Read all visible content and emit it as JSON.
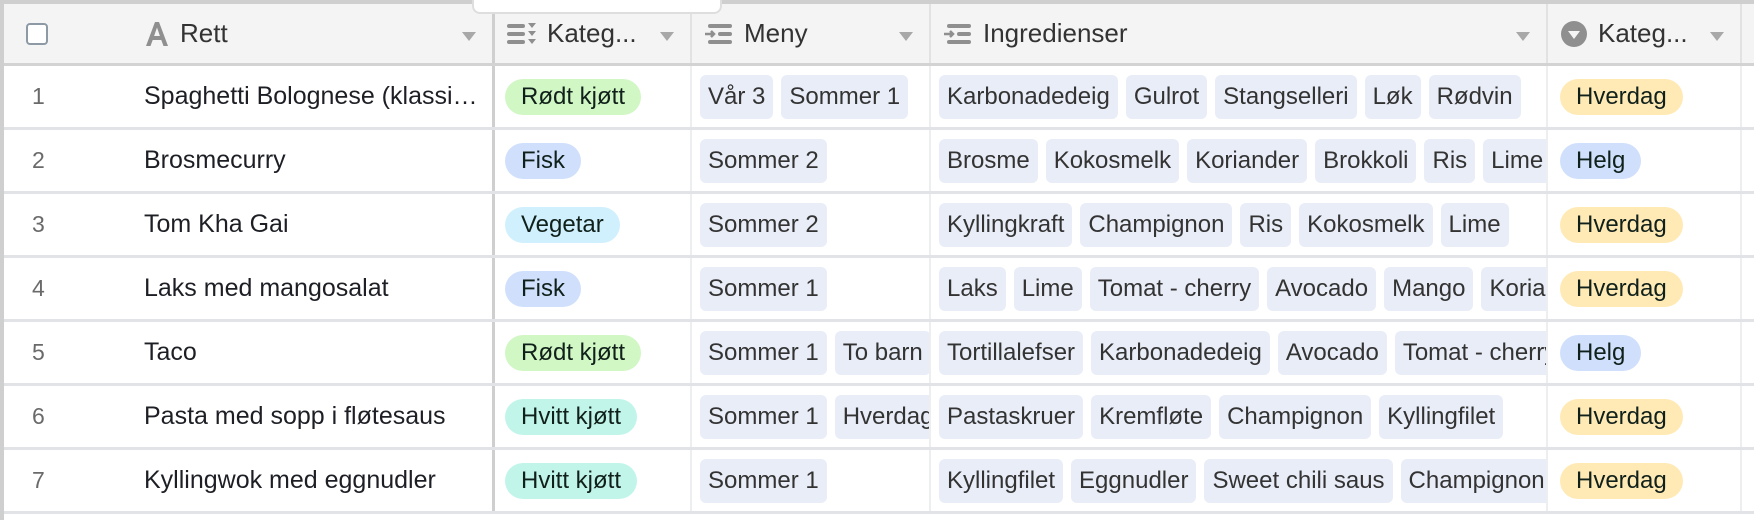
{
  "colors": {
    "rodt_kjott": "#d1f7c4",
    "fisk": "#d0e0fc",
    "vegetar": "#d0f0fd",
    "hvitt_kjott": "#c2f5e9",
    "hverdag": "#ffeab6",
    "helg": "#d0e0fc",
    "tag_bg": "#e9edf7"
  },
  "header": {
    "columns": [
      {
        "label": "Rett",
        "icon": "text-field-icon"
      },
      {
        "label": "Kateg...",
        "icon": "multiple-select-icon"
      },
      {
        "label": "Meny",
        "icon": "linked-record-icon"
      },
      {
        "label": "Ingredienser",
        "icon": "linked-record-icon"
      },
      {
        "label": "Kateg...",
        "icon": "single-select-icon"
      }
    ]
  },
  "rows": [
    {
      "num": "1",
      "name": "Spaghetti Bolognese (klassisk)",
      "kategori": "Rødt kjøtt",
      "kategori_color": "rodt_kjott",
      "meny": [
        "Vår 3",
        "Sommer 1"
      ],
      "ingredienser": [
        "Karbonadedeig",
        "Gulrot",
        "Stangselleri",
        "Løk",
        "Rødvin"
      ],
      "type": "Hverdag"
    },
    {
      "num": "2",
      "name": "Brosmecurry",
      "kategori": "Fisk",
      "kategori_color": "fisk",
      "meny": [
        "Sommer 2"
      ],
      "ingredienser": [
        "Brosme",
        "Kokosmelk",
        "Koriander",
        "Brokkoli",
        "Ris",
        "Lime"
      ],
      "type": "Helg"
    },
    {
      "num": "3",
      "name": "Tom Kha Gai",
      "kategori": "Vegetar",
      "kategori_color": "vegetar",
      "meny": [
        "Sommer 2"
      ],
      "ingredienser": [
        "Kyllingkraft",
        "Champignon",
        "Ris",
        "Kokosmelk",
        "Lime"
      ],
      "type": "Hverdag"
    },
    {
      "num": "4",
      "name": "Laks med mangosalat",
      "kategori": "Fisk",
      "kategori_color": "fisk",
      "meny": [
        "Sommer 1"
      ],
      "ingredienser": [
        "Laks",
        "Lime",
        "Tomat - cherry",
        "Avocado",
        "Mango",
        "Koriander"
      ],
      "type": "Hverdag"
    },
    {
      "num": "5",
      "name": "Taco",
      "kategori": "Rødt kjøtt",
      "kategori_color": "rodt_kjott",
      "meny": [
        "Sommer 1",
        "To barn"
      ],
      "ingredienser": [
        "Tortillalefser",
        "Karbonadedeig",
        "Avocado",
        "Tomat - cherry"
      ],
      "type": "Helg"
    },
    {
      "num": "6",
      "name": "Pasta med sopp i fløtesaus",
      "kategori": "Hvitt kjøtt",
      "kategori_color": "hvitt_kjott",
      "meny": [
        "Sommer 1",
        "Hverdag"
      ],
      "ingredienser": [
        "Pastaskruer",
        "Kremfløte",
        "Champignon",
        "Kyllingfilet"
      ],
      "type": "Hverdag"
    },
    {
      "num": "7",
      "name": "Kyllingwok med eggnudler",
      "kategori": "Hvitt kjøtt",
      "kategori_color": "hvitt_kjott",
      "meny": [
        "Sommer 1"
      ],
      "ingredienser": [
        "Kyllingfilet",
        "Eggnudler",
        "Sweet chili saus",
        "Champignon"
      ],
      "type": "Hverdag"
    }
  ]
}
